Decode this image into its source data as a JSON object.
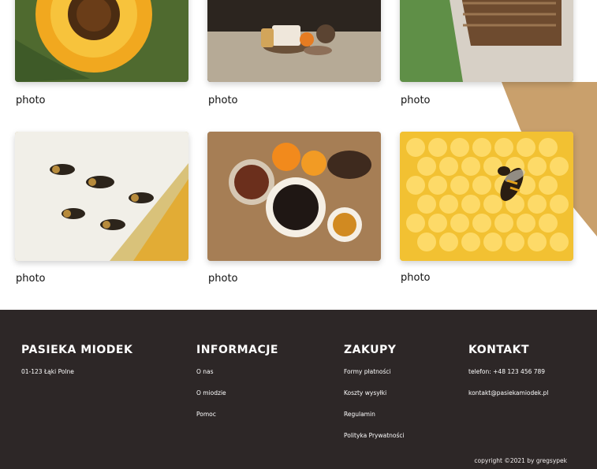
{
  "gallery": {
    "items": [
      {
        "caption": "photo",
        "subject": "sunflower"
      },
      {
        "caption": "photo",
        "subject": "tea-table"
      },
      {
        "caption": "photo",
        "subject": "beehive-frame"
      },
      {
        "caption": "photo",
        "subject": "bees-on-hive"
      },
      {
        "caption": "photo",
        "subject": "tea-oranges"
      },
      {
        "caption": "photo",
        "subject": "bee-on-honeycomb"
      }
    ]
  },
  "footer": {
    "brand": {
      "title": "Pasieka Miodek",
      "address": "01-123 Łąki Polne"
    },
    "info": {
      "title": "Informacje",
      "links": [
        "O nas",
        "O miodzie",
        "Pomoc"
      ]
    },
    "shop": {
      "title": "Zakupy",
      "links": [
        "Formy płatności",
        "Koszty wysyłki",
        "Regulamin",
        "Polityka Prywatności"
      ]
    },
    "contact": {
      "title": "Kontakt",
      "phone": "telefon: +48 123 456 789",
      "email": "kontakt@pasiekamiodek.pl"
    },
    "copyright": "copyright ©2021 by gregsypek"
  },
  "colors": {
    "accent": "#c9a06c",
    "footer_bg": "#2d2727",
    "text": "#111111",
    "footer_text": "#ffffff"
  }
}
